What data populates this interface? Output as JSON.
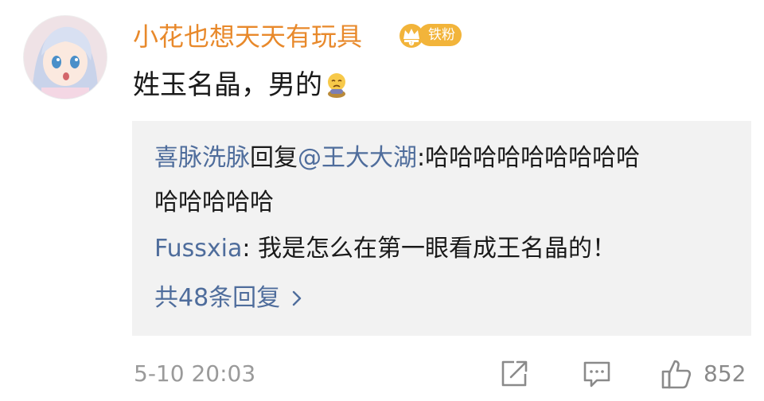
{
  "comment": {
    "username": "小花也想天天有玩具",
    "badge_label": "铁粉",
    "text": "姓玉名晶，男的",
    "emoji_icon": "sad-face-emoji-icon"
  },
  "replies": {
    "reply1": {
      "author": "喜脉洗脉",
      "verb": "回复",
      "mention": "@王大大湖",
      "line1_text": ":哈哈哈哈哈哈哈哈哈",
      "line2_text": "哈哈哈哈哈"
    },
    "reply2": {
      "author": "Fussxia",
      "text": ": 我是怎么在第一眼看成王名晶的！"
    },
    "more_label": "共48条回复"
  },
  "footer": {
    "timestamp": "5-10 20:03",
    "like_count": "852"
  },
  "colors": {
    "username": "#e8892b",
    "link": "#4f6d9c",
    "badge": "#f2b43a",
    "reply_bg": "#f2f2f2",
    "meta": "#9a9a9a"
  }
}
